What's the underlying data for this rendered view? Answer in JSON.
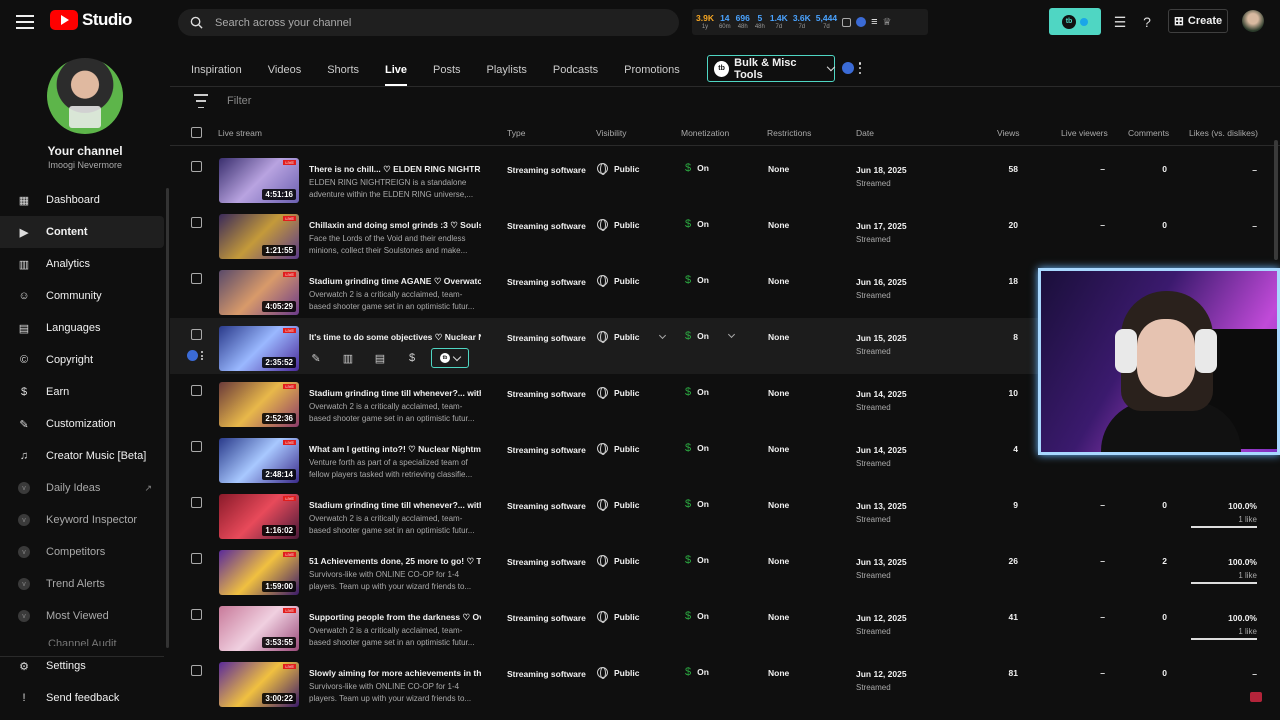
{
  "app": {
    "title": "Studio"
  },
  "search": {
    "placeholder": "Search across your channel"
  },
  "stats": [
    {
      "value": "3.9K",
      "label": "1y",
      "color": "#f5a623"
    },
    {
      "value": "14",
      "label": "60m",
      "color": "#4aa3ff"
    },
    {
      "value": "696",
      "label": "48h",
      "color": "#4aa3ff"
    },
    {
      "value": "5",
      "label": "48h",
      "color": "#4aa3ff"
    },
    {
      "value": "1.4K",
      "label": "7d",
      "color": "#4aa3ff"
    },
    {
      "value": "3.6K",
      "label": "7d",
      "color": "#4aa3ff"
    },
    {
      "value": "5,444",
      "label": "7d",
      "color": "#4aa3ff"
    }
  ],
  "header": {
    "create_label": "Create"
  },
  "channel": {
    "title": "Your channel",
    "name": "Imoogi Nevermore"
  },
  "sidebar": {
    "items": [
      {
        "label": "Dashboard",
        "icon": "dashboard-icon",
        "glyph": "▦",
        "active": false,
        "dim": false
      },
      {
        "label": "Content",
        "icon": "content-icon",
        "glyph": "▶",
        "active": true,
        "dim": false
      },
      {
        "label": "Analytics",
        "icon": "analytics-icon",
        "glyph": "▥",
        "active": false,
        "dim": false
      },
      {
        "label": "Community",
        "icon": "community-icon",
        "glyph": "☺",
        "active": false,
        "dim": false
      },
      {
        "label": "Languages",
        "icon": "languages-icon",
        "glyph": "▤",
        "active": false,
        "dim": false
      },
      {
        "label": "Copyright",
        "icon": "copyright-icon",
        "glyph": "©",
        "active": false,
        "dim": false
      },
      {
        "label": "Earn",
        "icon": "earn-icon",
        "glyph": "$",
        "active": false,
        "dim": false
      },
      {
        "label": "Customization",
        "icon": "customization-icon",
        "glyph": "✎",
        "active": false,
        "dim": false
      },
      {
        "label": "Creator Music [Beta]",
        "icon": "music-icon",
        "glyph": "♫",
        "active": false,
        "dim": false
      },
      {
        "label": "Daily Ideas",
        "icon": "vidiq-icon",
        "glyph": "v",
        "active": false,
        "dim": true,
        "external": true
      },
      {
        "label": "Keyword Inspector",
        "icon": "vidiq-icon",
        "glyph": "v",
        "active": false,
        "dim": true
      },
      {
        "label": "Competitors",
        "icon": "vidiq-icon",
        "glyph": "v",
        "active": false,
        "dim": true
      },
      {
        "label": "Trend Alerts",
        "icon": "vidiq-icon",
        "glyph": "v",
        "active": false,
        "dim": true
      },
      {
        "label": "Most Viewed",
        "icon": "vidiq-icon",
        "glyph": "v",
        "active": false,
        "dim": true
      }
    ],
    "cut_item": "Channel Audit",
    "bottom": [
      {
        "label": "Settings",
        "icon": "settings-icon",
        "glyph": "⚙"
      },
      {
        "label": "Send feedback",
        "icon": "feedback-icon",
        "glyph": "!"
      }
    ]
  },
  "tabs": [
    {
      "label": "Inspiration",
      "active": false
    },
    {
      "label": "Videos",
      "active": false
    },
    {
      "label": "Shorts",
      "active": false
    },
    {
      "label": "Live",
      "active": true
    },
    {
      "label": "Posts",
      "active": false
    },
    {
      "label": "Playlists",
      "active": false
    },
    {
      "label": "Podcasts",
      "active": false
    },
    {
      "label": "Promotions",
      "active": false
    }
  ],
  "bulk_tools": {
    "label": "Bulk & Misc Tools",
    "badge": "tb"
  },
  "filter": {
    "placeholder": "Filter"
  },
  "table": {
    "headers": {
      "live_stream": "Live stream",
      "type": "Type",
      "visibility": "Visibility",
      "monetization": "Monetization",
      "restrictions": "Restrictions",
      "date": "Date",
      "views": "Views",
      "live_viewers": "Live viewers",
      "comments": "Comments",
      "likes": "Likes (vs. dislikes)"
    },
    "rows": [
      {
        "title": "There is no chill... ♡ ELDEN RING NIGHTRE...",
        "desc": "ELDEN RING NIGHTREIGN is a standalone adventure within the ELDEN RING universe,...",
        "duration": "4:51:16",
        "type": "Streaming software",
        "visibility": "Public",
        "monetization": "On",
        "restrictions": "None",
        "date": "Jun 18, 2025",
        "date_sub": "Streamed",
        "views": "58",
        "live_viewers": "–",
        "comments": "0",
        "likes": "–",
        "likes_sub": "",
        "like_ratio": null,
        "thumb": [
          "#3a2f6e",
          "#b8a3e0",
          "#6a5fb0"
        ]
      },
      {
        "title": "Chillaxin and doing smol grinds :3 ♡ Soulst...",
        "desc": "Face the Lords of the Void and their endless minions, collect their Soulstones and make...",
        "duration": "1:21:55",
        "type": "Streaming software",
        "visibility": "Public",
        "monetization": "On",
        "restrictions": "None",
        "date": "Jun 17, 2025",
        "date_sub": "Streamed",
        "views": "20",
        "live_viewers": "–",
        "comments": "0",
        "likes": "–",
        "likes_sub": "",
        "like_ratio": null,
        "thumb": [
          "#3a2a5a",
          "#c49a3a",
          "#5a3a8a"
        ]
      },
      {
        "title": "Stadium grinding time AGANE ♡ Overwatc...",
        "desc": "Overwatch 2 is a critically acclaimed, team-based shooter game set in an optimistic futur...",
        "duration": "4:05:29",
        "type": "Streaming software",
        "visibility": "Public",
        "monetization": "On",
        "restrictions": "None",
        "date": "Jun 16, 2025",
        "date_sub": "Streamed",
        "views": "18",
        "live_viewers": "",
        "comments": "",
        "likes": "",
        "likes_sub": "",
        "like_ratio": null,
        "thumb": [
          "#5a4a6a",
          "#d89a6a",
          "#6a3a8a"
        ]
      },
      {
        "title": "It's time to do some objectives ♡ Nuclear N...",
        "desc": "",
        "duration": "2:35:52",
        "type": "Streaming software",
        "visibility": "Public",
        "monetization": "On",
        "restrictions": "None",
        "date": "Jun 15, 2025",
        "date_sub": "Streamed",
        "views": "8",
        "live_viewers": "",
        "comments": "",
        "likes": "",
        "likes_sub": "",
        "like_ratio": null,
        "hover": true,
        "thumb": [
          "#2a3a8a",
          "#9ab8ff",
          "#4a2a9a"
        ]
      },
      {
        "title": "Stadium grinding time till whenever?... with...",
        "desc": "Overwatch 2 is a critically acclaimed, team-based shooter game set in an optimistic futur...",
        "duration": "2:52:36",
        "type": "Streaming software",
        "visibility": "Public",
        "monetization": "On",
        "restrictions": "None",
        "date": "Jun 14, 2025",
        "date_sub": "Streamed",
        "views": "10",
        "live_viewers": "",
        "comments": "",
        "likes": "",
        "likes_sub": "",
        "like_ratio": null,
        "thumb": [
          "#6a3a3a",
          "#e8b84a",
          "#8a3a6a"
        ]
      },
      {
        "title": "What am I getting into?! ♡ Nuclear Nightm...",
        "desc": "Venture forth as part of a specialized team of fellow players tasked with retrieving classifie...",
        "duration": "2:48:14",
        "type": "Streaming software",
        "visibility": "Public",
        "monetization": "On",
        "restrictions": "None",
        "date": "Jun 14, 2025",
        "date_sub": "Streamed",
        "views": "4",
        "live_viewers": "",
        "comments": "",
        "likes": "",
        "likes_sub": "",
        "like_ratio": null,
        "thumb": [
          "#2a3a8a",
          "#a8c8ff",
          "#3a2a8a"
        ]
      },
      {
        "title": "Stadium grinding time till whenever?... with...",
        "desc": "Overwatch 2 is a critically acclaimed, team-based shooter game set in an optimistic futur...",
        "duration": "1:16:02",
        "type": "Streaming software",
        "visibility": "Public",
        "monetization": "On",
        "restrictions": "None",
        "date": "Jun 13, 2025",
        "date_sub": "Streamed",
        "views": "9",
        "live_viewers": "–",
        "comments": "0",
        "likes": "100.0%",
        "likes_sub": "1 like",
        "like_ratio": 1.0,
        "thumb": [
          "#8a1a2a",
          "#e84a5a",
          "#4a1a3a"
        ]
      },
      {
        "title": "51 Achievements done, 25 more to go! ♡ T...",
        "desc": "Survivors-like with ONLINE CO-OP for 1-4 players. Team up with your wizard friends to...",
        "duration": "1:59:00",
        "type": "Streaming software",
        "visibility": "Public",
        "monetization": "On",
        "restrictions": "None",
        "date": "Jun 13, 2025",
        "date_sub": "Streamed",
        "views": "26",
        "live_viewers": "–",
        "comments": "2",
        "likes": "100.0%",
        "likes_sub": "1 like",
        "like_ratio": 1.0,
        "thumb": [
          "#5a2a9a",
          "#f0c040",
          "#3a1a6a"
        ]
      },
      {
        "title": "Supporting people from the darkness ♡ Ov...",
        "desc": "Overwatch 2 is a critically acclaimed, team-based shooter game set in an optimistic futur...",
        "duration": "3:53:55",
        "type": "Streaming software",
        "visibility": "Public",
        "monetization": "On",
        "restrictions": "None",
        "date": "Jun 12, 2025",
        "date_sub": "Streamed",
        "views": "41",
        "live_viewers": "–",
        "comments": "0",
        "likes": "100.0%",
        "likes_sub": "1 like",
        "like_ratio": 1.0,
        "thumb": [
          "#c87a9a",
          "#f0d0e0",
          "#9a4a7a"
        ]
      },
      {
        "title": "Slowly aiming for more achievements in thi...",
        "desc": "Survivors-like with ONLINE CO-OP for 1-4 players. Team up with your wizard friends to...",
        "duration": "3:00:22",
        "type": "Streaming software",
        "visibility": "Public",
        "monetization": "On",
        "restrictions": "None",
        "date": "Jun 12, 2025",
        "date_sub": "Streamed",
        "views": "81",
        "live_viewers": "–",
        "comments": "0",
        "likes": "–",
        "likes_sub": "",
        "like_ratio": null,
        "thumb": [
          "#5a2a9a",
          "#f0c040",
          "#3a1a6a"
        ]
      }
    ]
  }
}
